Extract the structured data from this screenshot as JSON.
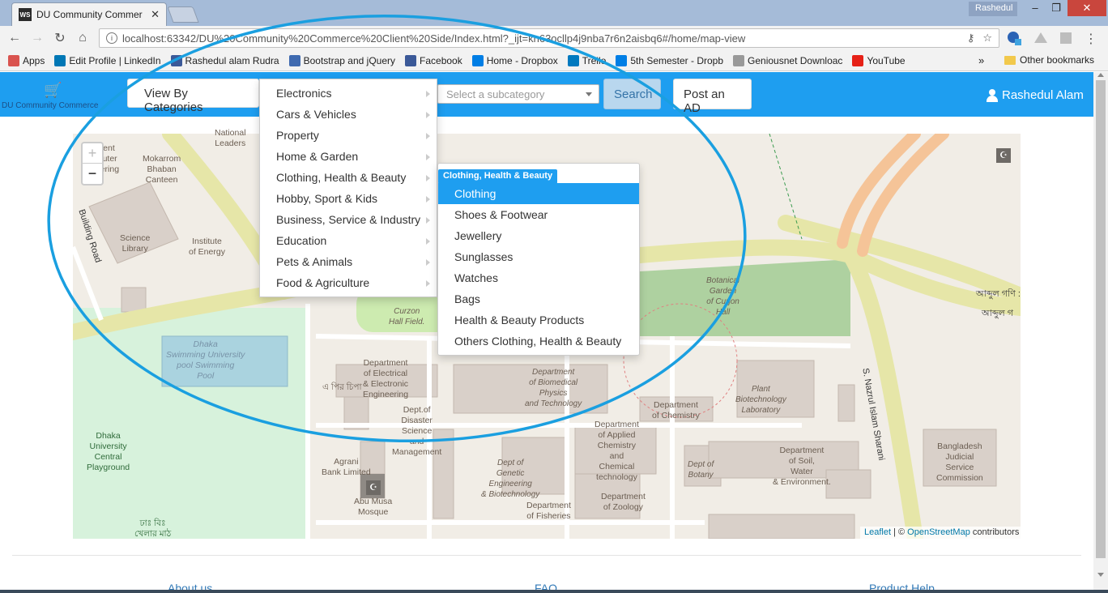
{
  "browser": {
    "tab_title": "DU Community Commer",
    "tab_favicon": "WS",
    "profile_name": "Rashedul",
    "url": "localhost:63342/DU%20Community%20Commerce%20Client%20Side/Index.html?_ijt=kn63ocllp4j9nba7r6n2aisbq6#/home/map-view",
    "bookmarks": [
      {
        "label": "Apps",
        "icon": "apps-grid-icon",
        "color": "#d9534f"
      },
      {
        "label": "Edit Profile | LinkedIn",
        "icon": "linkedin-icon",
        "color": "#0077b5"
      },
      {
        "label": "Rashedul alam Rudra",
        "icon": "photo-icon",
        "color": "#3b5998"
      },
      {
        "label": "Bootstrap and jQuery",
        "icon": "bootstrap-icon",
        "color": "#3f6ab0"
      },
      {
        "label": "Facebook",
        "icon": "facebook-icon",
        "color": "#3b5998"
      },
      {
        "label": "Home - Dropbox",
        "icon": "dropbox-icon",
        "color": "#007ee5"
      },
      {
        "label": "Trello",
        "icon": "trello-icon",
        "color": "#0079bf"
      },
      {
        "label": "5th Semester - Dropb",
        "icon": "dropbox-icon",
        "color": "#007ee5"
      },
      {
        "label": "Geniousnet Downloac",
        "icon": "page-icon",
        "color": "#999999"
      },
      {
        "label": "YouTube",
        "icon": "youtube-icon",
        "color": "#e62117"
      }
    ],
    "bookmarks_more": "»",
    "other_bookmarks": "Other bookmarks"
  },
  "navbar": {
    "logo_text": "DU Community Commerce",
    "categories_button": "View By Categories",
    "subcategory_placeholder": "Select a subcategory",
    "search_button": "Search",
    "post_ad_button": "Post an AD",
    "user_name": "Rashedul Alam",
    "accent_color": "#1e9ef0"
  },
  "categories": [
    "Electronics",
    "Cars & Vehicles",
    "Property",
    "Home & Garden",
    "Clothing, Health & Beauty",
    "Hobby, Sport & Kids",
    "Business, Service & Industry",
    "Education",
    "Pets & Animals",
    "Food & Agriculture"
  ],
  "submenu": {
    "header": "Clothing, Health & Beauty",
    "items": [
      "Clothing",
      "Shoes & Footwear",
      "Jewellery",
      "Sunglasses",
      "Watches",
      "Bags",
      "Health & Beauty Products",
      "Others Clothing, Health & Beauty"
    ],
    "active_index": 0
  },
  "map": {
    "zoom_in": "+",
    "zoom_out": "−",
    "attribution_leaflet": "Leaflet",
    "attribution_sep": " | © ",
    "attribution_osm": "OpenStreetMap",
    "attribution_tail": " contributors",
    "labels": {
      "national_leaders": "National\nLeaders",
      "computer_eng": "rtment\nmputer\nneering",
      "mokarrom": "Mokarrom\nBhaban\nCanteen",
      "building_road": "Building Road",
      "science_library": "Science\nLibrary",
      "institute_energy": "Institute\nof Energy",
      "curzon_field": "Curzon\nHall Field.",
      "swimming_pool": "Dhaka\nSwimming University\npool     Swimming\nPool",
      "dept_eee": "Department\nof Electrical\n& Electronic\nEngineering",
      "pir_chipa": "এ পির চিপা",
      "dept_disaster": "Dept.of\nDisaster\nScience\nand\nManagement",
      "dept_biomedical": "Department\nof Biomedical\nPhysics\nand Technology",
      "dept_chemistry": "Department\nof Chemistry",
      "botanical_garden": "Botanical\nGarden\nof Curjon\nHall",
      "plant_biotech": "Plant\nBiotechnology\nLaboratory",
      "playground": "Dhaka\nUniversity\nCentral\nPlayground",
      "agrani": "Agrani\nBank Limited",
      "abu_musa": "Abu Musa\nMosque",
      "genetic_eng": "Dept of\nGenetic\nEngineering\n& Biotechnology",
      "applied_chem": "Department\nof Applied\nChemistry\nand\nChemical\ntechnology",
      "zoology": "Department\nof Zoology",
      "fisheries": "Department\nof Fisheries",
      "botany": "Dept of\nBotany",
      "soil_water": "Department\nof Soil,\nWater\n& Environment.",
      "bjsc": "Bangladesh\nJudicial\nService\nCommission",
      "nazrul_sharani": "S. Nazrul Islam Sharani",
      "abdul_gani_1": "আব্দুল গণি :",
      "abdul_gani_2": "আব্দুল গ",
      "tab_field": "ঢাঃ বিঃ\nখেলার মাঠ"
    }
  },
  "footer": {
    "links": [
      "About us",
      "FAQ",
      "Product Help"
    ]
  }
}
